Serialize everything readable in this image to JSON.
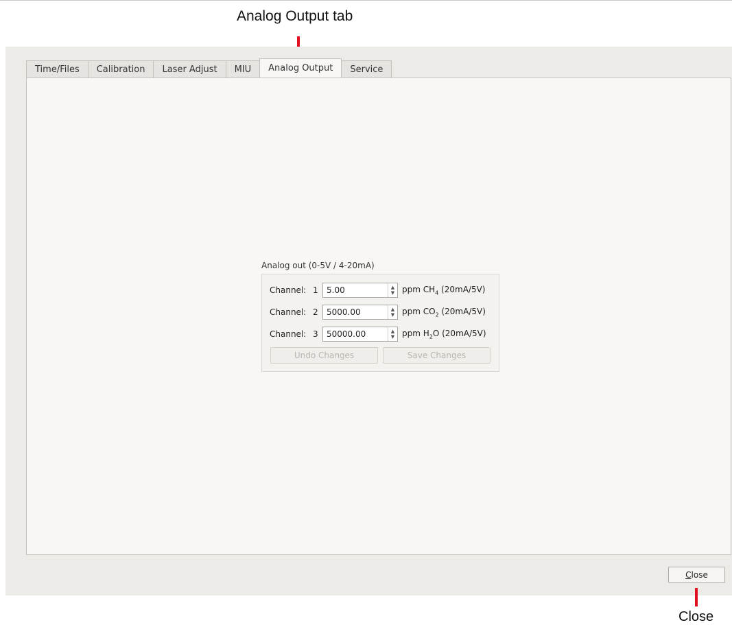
{
  "annotations": {
    "tab_callout": "Analog Output tab",
    "close_callout": "Close"
  },
  "tabs": [
    {
      "label": "Time/Files",
      "active": false
    },
    {
      "label": "Calibration",
      "active": false
    },
    {
      "label": "Laser Adjust",
      "active": false
    },
    {
      "label": "MIU",
      "active": false
    },
    {
      "label": "Analog Output",
      "active": true
    },
    {
      "label": "Service",
      "active": false
    }
  ],
  "analog_group": {
    "title": "Analog out (0-5V / 4-20mA)",
    "channel_label": "Channel:",
    "channels": [
      {
        "number": "1",
        "value": "5.00",
        "unit_prefix": "ppm CH",
        "subscript": "4",
        "unit_suffix": " (20mA/5V)"
      },
      {
        "number": "2",
        "value": "5000.00",
        "unit_prefix": "ppm CO",
        "subscript": "2",
        "unit_suffix": " (20mA/5V)"
      },
      {
        "number": "3",
        "value": "50000.00",
        "unit_prefix": "ppm H",
        "subscript": "2",
        "unit_suffix": "O (20mA/5V)"
      }
    ],
    "undo_label": "Undo Changes",
    "save_label": "Save Changes"
  },
  "footer": {
    "close_mnemonic": "C",
    "close_rest": "lose"
  },
  "colors": {
    "annotation_red": "#e0101e",
    "window_bg": "#ecebe8",
    "panel_bg": "#f8f7f5"
  }
}
